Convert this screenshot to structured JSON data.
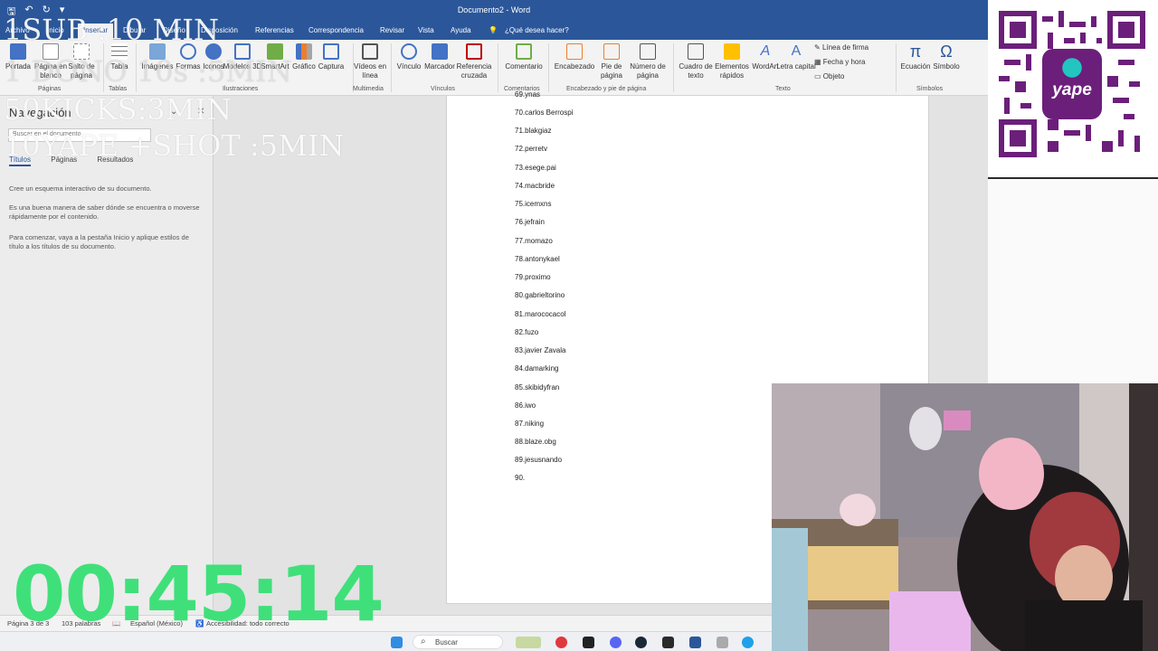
{
  "app": {
    "window_title": "Documento2  -  Word"
  },
  "tabs": [
    "Archivo",
    "Inicio",
    "Insertar",
    "Dibujar",
    "Diseño",
    "Disposición",
    "Referencias",
    "Correspondencia",
    "Revisar",
    "Vista",
    "Ayuda",
    "¿Qué desea hacer?"
  ],
  "ribbon": {
    "buttons": [
      {
        "label": "Portada"
      },
      {
        "label": "Página en blanco"
      },
      {
        "label": "Salto de página"
      },
      {
        "label": "Tabla"
      },
      {
        "label": "Imágenes"
      },
      {
        "label": "Formas"
      },
      {
        "label": "Iconos"
      },
      {
        "label": "Modelos 3D"
      },
      {
        "label": "SmartArt"
      },
      {
        "label": "Gráfico"
      },
      {
        "label": "Captura"
      },
      {
        "label": "Vídeos en línea"
      },
      {
        "label": "Vínculo"
      },
      {
        "label": "Marcador"
      },
      {
        "label": "Referencia cruzada"
      },
      {
        "label": "Comentario"
      },
      {
        "label": "Encabezado"
      },
      {
        "label": "Pie de página"
      },
      {
        "label": "Número de página"
      },
      {
        "label": "Cuadro de texto"
      },
      {
        "label": "Elementos rápidos"
      },
      {
        "label": "WordArt"
      },
      {
        "label": "Letra capital"
      },
      {
        "label": "Ecuación"
      },
      {
        "label": "Símbolo"
      }
    ],
    "small_items": [
      "Línea de firma",
      "Fecha y hora",
      "Objeto"
    ],
    "groups": [
      "Páginas",
      "Tablas",
      "Ilustraciones",
      "Multimedia",
      "Vínculos",
      "Comentarios",
      "Encabezado y pie de página",
      "Texto",
      "Símbolos"
    ]
  },
  "nav": {
    "title": "Navegación",
    "search_placeholder": "Buscar en el documento",
    "tabs": [
      "Títulos",
      "Páginas",
      "Resultados"
    ],
    "paragraphs": [
      "Cree un esquema interactivo de su documento.",
      "Es una buena manera de saber dónde se encuentra o moverse rápidamente por el contenido.",
      "Para comenzar, vaya a la pestaña Inicio y aplique estilos de título a los títulos de su documento."
    ]
  },
  "document": {
    "lines": [
      "69.ynas",
      "70.carlos Berrospi",
      "71.blakgiaz",
      "72.perretv",
      "73.esege.pai",
      "74.macbride",
      "75.icemxns",
      "76.jefrain",
      "77.momazo",
      "78.antonykael",
      "79.proximo",
      "80.gabrieltorino",
      "81.marococacol",
      "82.fuzo",
      "83.javier Zavala",
      "84.damarking",
      "85.skibidyfran",
      "86.iwo",
      "87.niking",
      "88.blaze.obg",
      "89.jesusnando",
      "90."
    ]
  },
  "statusbar": {
    "page": "Página 3 de 3",
    "words": "103 palabras",
    "language": "Español (México)",
    "accessibility": "Accesibilidad: todo correcto"
  },
  "taskbar": {
    "search_label": "Buscar"
  },
  "overlay": {
    "line1": "1SUB :10 MIN",
    "line2": "1 DONO 10s :5MIN",
    "line3": "50KICKS:3MIN",
    "line4": "10YAPE +SHOT :5MIN",
    "timer": "00:45:14"
  },
  "colors": {
    "word_blue": "#2b579a",
    "timer_green": "#3fe07a",
    "yape_purple": "#6b1f7a"
  }
}
